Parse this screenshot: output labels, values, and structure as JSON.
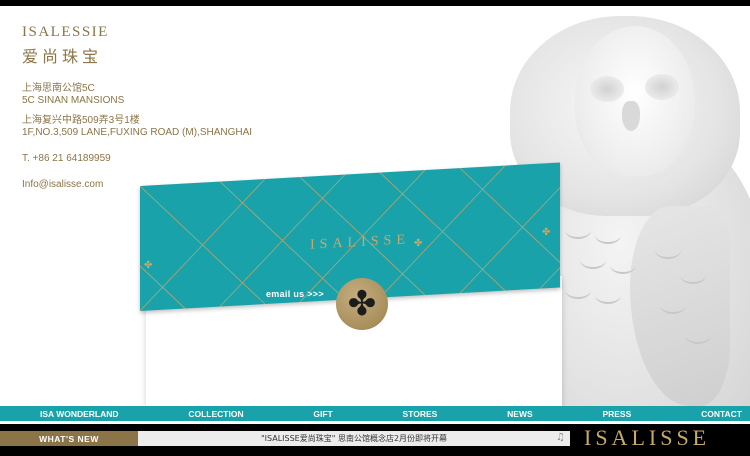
{
  "brand": {
    "name_en": "ISALESSIE",
    "name_cn": "爱尚珠宝"
  },
  "store": {
    "cn_name": "上海思南公馆5C",
    "en_name": "5C SINAN MANSIONS",
    "cn_address": "上海复兴中路509弄3号1楼",
    "en_address": "1F,NO.3,509 LANE,FUXING ROAD (M),SHANGHAI",
    "phone": "T. +86 21 64189959",
    "email": "Info@isalisse.com"
  },
  "envelope": {
    "logo": "ISALISSE",
    "email_link": "email us >>>",
    "seal_icon": "clover-icon"
  },
  "nav": {
    "items": [
      {
        "label": "ISA WONDERLAND"
      },
      {
        "label": "COLLECTION"
      },
      {
        "label": "GIFT"
      },
      {
        "label": "STORES"
      },
      {
        "label": "NEWS"
      },
      {
        "label": "PRESS"
      },
      {
        "label": "CONTACT"
      }
    ]
  },
  "ticker": {
    "label": "WHAT'S NEW",
    "text": "\"ISALISSE爱尚珠宝\"  思南公馆概念店2月份即将开幕",
    "music_icon": "music-icon",
    "logo": "ISALISSE"
  },
  "colors": {
    "gold": "#8b7448",
    "teal": "#1aa2ab",
    "black": "#000000"
  }
}
